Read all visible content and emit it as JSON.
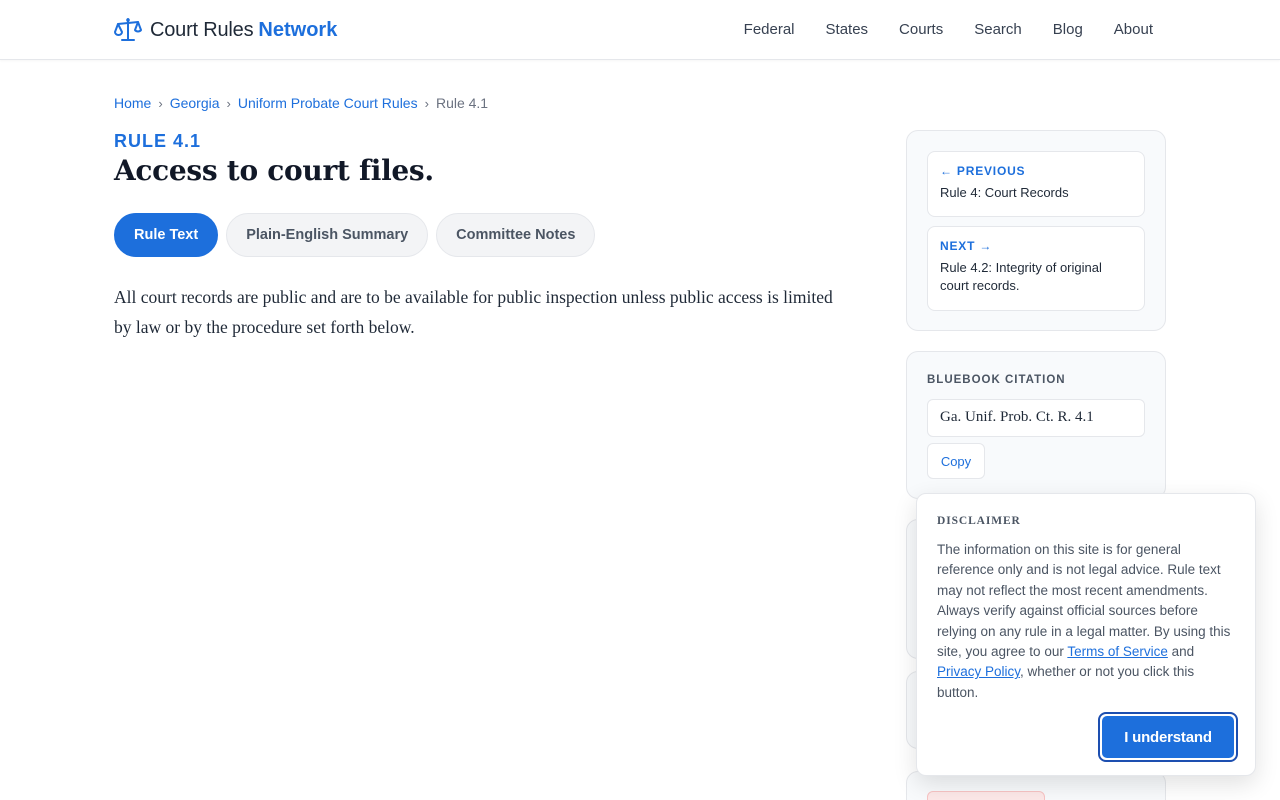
{
  "header": {
    "brand_name": "Court Rules",
    "brand_accent": "Network",
    "brand_icon": "scales-icon",
    "accent_color": "#1d6fdc",
    "nav": [
      "Federal",
      "States",
      "Courts",
      "Search",
      "Blog",
      "About"
    ]
  },
  "breadcrumb": {
    "items": [
      "Home",
      "Georgia",
      "Uniform Probate Court Rules"
    ],
    "current": "Rule 4.1",
    "separator": "›"
  },
  "rule": {
    "number_label": "RULE 4.1",
    "title": "Access to court files.",
    "body": "All court records are public and are to be available for public inspection unless public access is limited by law or by the procedure set forth below."
  },
  "tabs": [
    {
      "label": "Rule Text",
      "active": true
    },
    {
      "label": "Plain-English Summary",
      "active": false
    },
    {
      "label": "Committee Notes",
      "active": false
    }
  ],
  "sidebar": {
    "previous": {
      "kicker": "← PREVIOUS",
      "target": "Rule 4: Court Records"
    },
    "next": {
      "kicker": "NEXT →",
      "target": "Rule 4.2: Integrity of original court records."
    },
    "citation": {
      "label": "BLUEBOOK CITATION",
      "value": "Ga. Unif. Prob. Ct. R. 4.1",
      "copy_label": "Copy"
    }
  },
  "disclaimer": {
    "title": "DISCLAIMER",
    "text_before": "The information on this site is for general reference only and is not legal advice. Rule text may not reflect the most recent amendments. Always verify against official sources before relying on any rule in a legal matter. By using this site, you agree to our ",
    "terms_link": "Terms of Service",
    "text_mid": " and ",
    "privacy_link": "Privacy Policy",
    "text_after": ", whether or not you click this button.",
    "button_label": "I understand"
  }
}
